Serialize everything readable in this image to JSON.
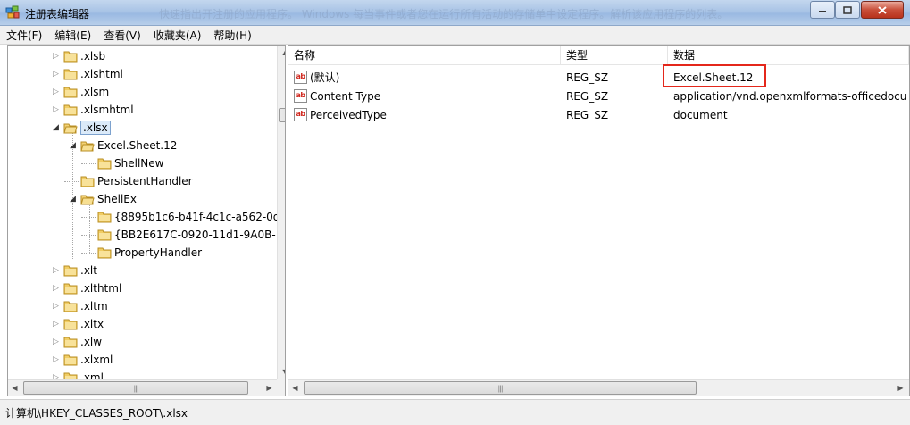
{
  "window": {
    "title": "注册表编辑器",
    "ghost_title": "快速指出开注册的应用程序。 Windows 每当事件或者您在运行所有活动的存储单中设定程序。解析该应用程序的列表。"
  },
  "menu": {
    "items": [
      "文件(F)",
      "编辑(E)",
      "查看(V)",
      "收藏夹(A)",
      "帮助(H)"
    ]
  },
  "tree": {
    "items": [
      {
        "label": ".xlsb",
        "expander": "collapsed"
      },
      {
        "label": ".xlshtml",
        "expander": "collapsed"
      },
      {
        "label": ".xlsm",
        "expander": "collapsed"
      },
      {
        "label": ".xlsmhtml",
        "expander": "collapsed"
      },
      {
        "label": ".xlsx",
        "expander": "expanded",
        "selected": true
      },
      {
        "label": "Excel.Sheet.12",
        "expander": "expanded"
      },
      {
        "label": "ShellNew",
        "expander": "none"
      },
      {
        "label": "PersistentHandler",
        "expander": "none"
      },
      {
        "label": "ShellEx",
        "expander": "expanded"
      },
      {
        "label": "{8895b1c6-b41f-4c1c-a562-0d",
        "expander": "none"
      },
      {
        "label": "{BB2E617C-0920-11d1-9A0B-",
        "expander": "none"
      },
      {
        "label": "PropertyHandler",
        "expander": "none"
      },
      {
        "label": ".xlt",
        "expander": "collapsed"
      },
      {
        "label": ".xlthtml",
        "expander": "collapsed"
      },
      {
        "label": ".xltm",
        "expander": "collapsed"
      },
      {
        "label": ".xltx",
        "expander": "collapsed"
      },
      {
        "label": ".xlw",
        "expander": "collapsed"
      },
      {
        "label": ".xlxml",
        "expander": "collapsed"
      },
      {
        "label": ".xml",
        "expander": "collapsed"
      }
    ]
  },
  "list": {
    "headers": {
      "name": "名称",
      "type": "类型",
      "data": "数据"
    },
    "rows": [
      {
        "name": "(默认)",
        "type": "REG_SZ",
        "data": "Excel.Sheet.12",
        "highlighted": true
      },
      {
        "name": "Content Type",
        "type": "REG_SZ",
        "data": "application/vnd.openxmlformats-officedocu"
      },
      {
        "name": "PerceivedType",
        "type": "REG_SZ",
        "data": "document"
      }
    ],
    "value_icon": "ab-string-icon"
  },
  "status": {
    "path": "计算机\\HKEY_CLASSES_ROOT\\.xlsx"
  },
  "colors": {
    "highlight_box": "#e4271b",
    "selection": "#dbeaf9",
    "folder": "#e9c35a"
  }
}
